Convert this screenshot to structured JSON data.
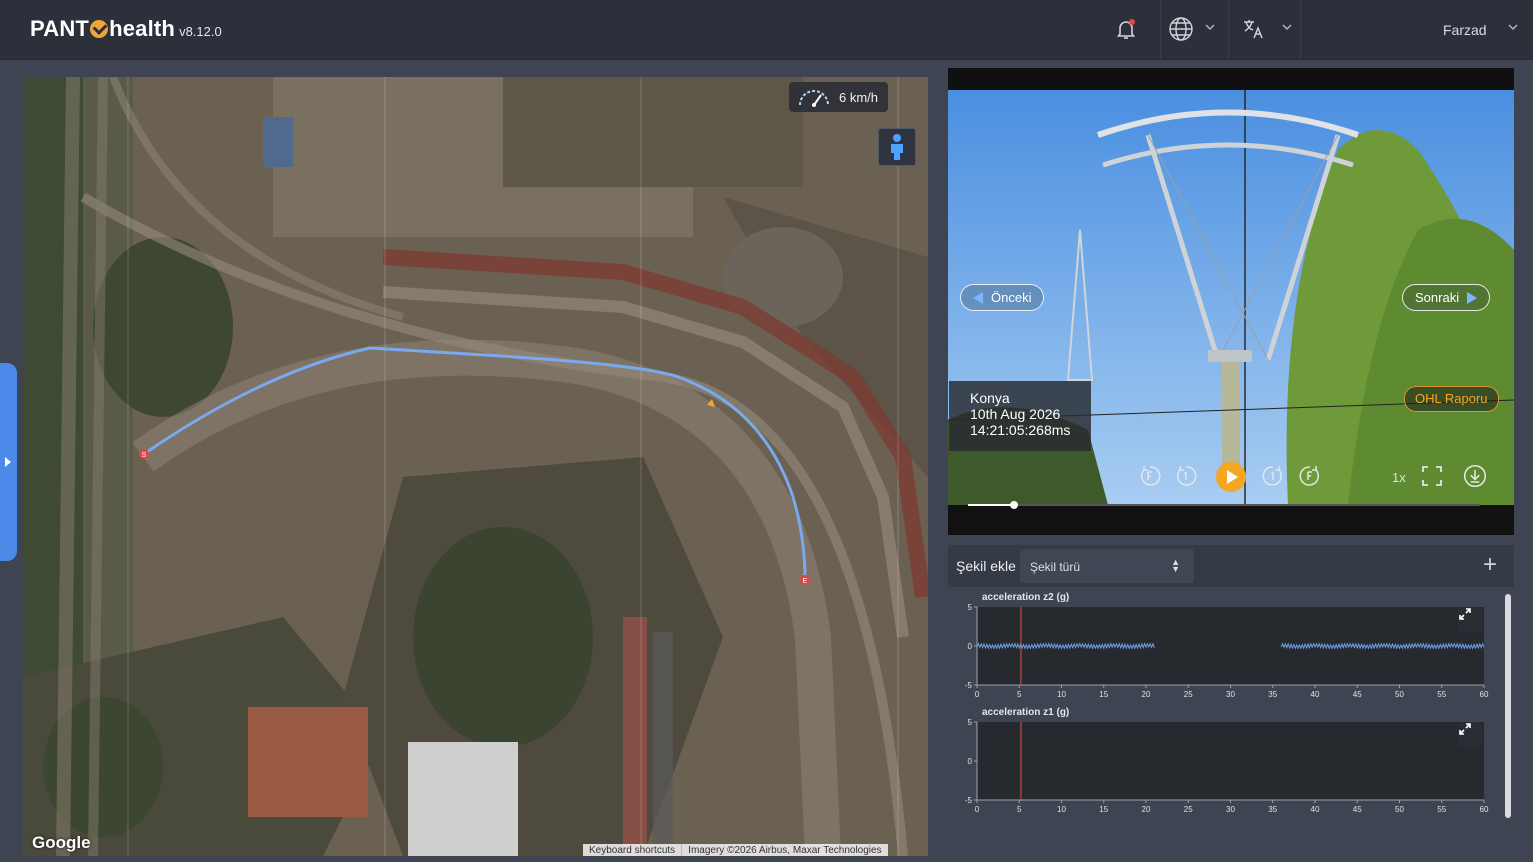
{
  "header": {
    "brand_name_before": "PANT",
    "brand_name_after": "health",
    "version": "v8.12.0",
    "user_name": "Farzad"
  },
  "map": {
    "speed": "6 km/h",
    "google_logo": "Google",
    "footer_shortcuts": "Keyboard shortcuts",
    "footer_imagery": "Imagery ©2026 Airbus, Maxar Technologies",
    "start_marker": "S",
    "end_marker": "E",
    "route_color": "#79a9ee"
  },
  "video": {
    "prev_label": "Önceki",
    "next_label": "Sonraki",
    "location": "Konya",
    "date": "10th Aug 2026",
    "time": "14:21:05:268ms",
    "ohl_report": "OHL Raporu",
    "playback_speed": "1x",
    "progress": 0.09
  },
  "chart_toolbar": {
    "label": "Şekil ekle",
    "select_placeholder": "Şekil türü"
  },
  "chart_data": [
    {
      "type": "line",
      "title": "acceleration z2 (g)",
      "xlim": [
        0,
        60
      ],
      "ylim": [
        -5,
        5
      ],
      "xticks": [
        0,
        5,
        10,
        15,
        20,
        25,
        30,
        35,
        40,
        45,
        50,
        55,
        60
      ],
      "yticks": [
        5,
        0,
        -5
      ],
      "marker_x": 5.2,
      "series": [
        {
          "segments": [
            [
              0,
              21
            ],
            [
              36,
              60
            ]
          ],
          "amplitude": 0.3
        }
      ]
    },
    {
      "type": "line",
      "title": "acceleration z1 (g)",
      "xlim": [
        0,
        60
      ],
      "ylim": [
        -5,
        5
      ],
      "xticks": [
        0,
        5,
        10,
        15,
        20,
        25,
        30,
        35,
        40,
        45,
        50,
        55,
        60
      ],
      "yticks": [
        5,
        0,
        -5
      ],
      "marker_x": 5.2,
      "series": []
    }
  ]
}
